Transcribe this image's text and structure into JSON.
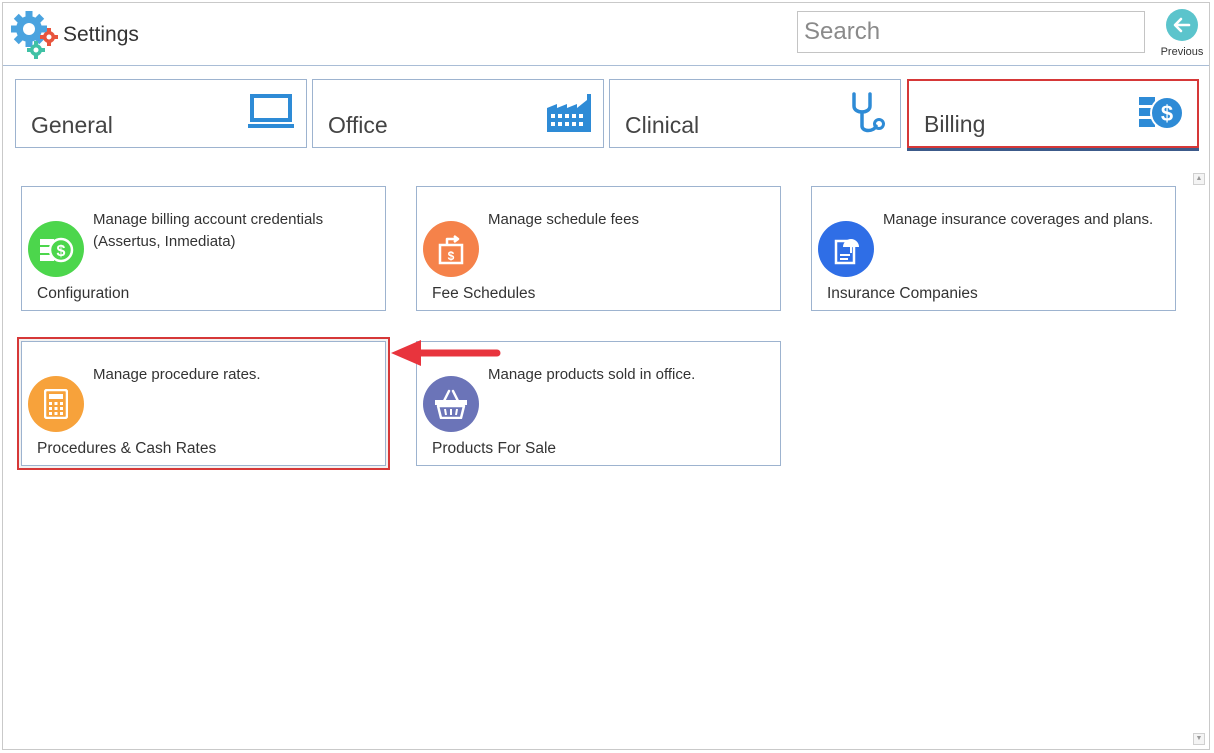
{
  "app": {
    "title": "Settings"
  },
  "search": {
    "placeholder": "Search",
    "value": ""
  },
  "previous": {
    "label": "Previous"
  },
  "tabs": [
    {
      "label": "General",
      "icon": "monitor-icon"
    },
    {
      "label": "Office",
      "icon": "factory-icon"
    },
    {
      "label": "Clinical",
      "icon": "stethoscope-icon"
    },
    {
      "label": "Billing",
      "icon": "billing-dollar-icon",
      "active": true
    }
  ],
  "cards": [
    {
      "title": "Configuration",
      "desc": "Manage billing account credentials (Assertus, Inmediata)",
      "icon": "money-dollar-icon",
      "color": "#4cd64c"
    },
    {
      "title": "Fee Schedules",
      "desc": "Manage schedule fees",
      "icon": "fee-schedule-icon",
      "color": "#f5824a"
    },
    {
      "title": "Insurance Companies",
      "desc": "Manage insurance coverages and plans.",
      "icon": "insurance-umbrella-icon",
      "color": "#2f6ee6"
    },
    {
      "title": "Procedures & Cash Rates",
      "desc": "Manage procedure rates.",
      "icon": "calculator-icon",
      "color": "#f7a23b",
      "highlighted": true
    },
    {
      "title": "Products For Sale",
      "desc": "Manage products sold in office.",
      "icon": "basket-icon",
      "color": "#6b74b8"
    }
  ],
  "colors": {
    "accent": "#2e8bd6",
    "highlight": "#d63838",
    "border": "#9db3cf"
  }
}
